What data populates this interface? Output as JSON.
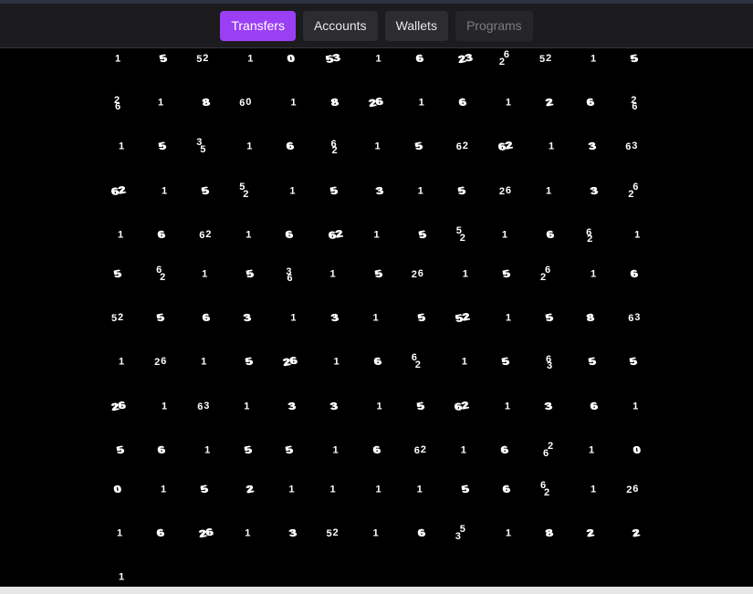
{
  "tabs": [
    {
      "label": "Transfers",
      "state": "active"
    },
    {
      "label": "Accounts",
      "state": "normal"
    },
    {
      "label": "Wallets",
      "state": "normal"
    },
    {
      "label": "Programs",
      "state": "disabled"
    }
  ],
  "colors": {
    "background": "#000000",
    "toolbar": "#1c1c1f",
    "tab": "#2d2d31",
    "tab_active": "#9b3ff5",
    "glyph": "#ffffff"
  },
  "grid": {
    "rows": [
      [
        "1",
        "5",
        "5|2",
        "1",
        "0",
        "53",
        "1",
        "6",
        "23",
        "6|2",
        "5|2",
        "1",
        "5"
      ],
      [
        "2|6",
        "1",
        "8",
        "6|0",
        "1",
        "8",
        "26",
        "1",
        "6",
        "1",
        "2",
        "6",
        "2|6"
      ],
      [
        "1",
        "5",
        "3|5",
        "1",
        "6",
        "6|2",
        "1",
        "5",
        "6|2",
        "62",
        "1",
        "3",
        "6|3"
      ],
      [
        "62",
        "1",
        "5",
        "5|2",
        "1",
        "5",
        "3",
        "1",
        "5",
        "2|6",
        "1",
        "3",
        "6|2"
      ],
      [
        "1",
        "6",
        "6|2",
        "1",
        "6",
        "62",
        "1",
        "5",
        "5|2",
        "1",
        "6",
        "6|2",
        "1"
      ],
      [
        "5",
        "6|2",
        "1",
        "5",
        "3|6",
        "1",
        "5",
        "2|6",
        "1",
        "5",
        "6|2",
        "1",
        "6"
      ],
      [
        "5|2",
        "5",
        "6",
        "3",
        "1",
        "3",
        "1",
        "5",
        "52",
        "1",
        "5",
        "8",
        "6|3"
      ],
      [
        "1",
        "2|6",
        "1",
        "5",
        "26",
        "1",
        "6",
        "6|2",
        "1",
        "5",
        "6|3",
        "5",
        "5"
      ],
      [
        "26",
        "1",
        "6|3",
        "1",
        "3",
        "3",
        "1",
        "5",
        "62",
        "1",
        "3",
        "6",
        "1"
      ],
      [
        "5",
        "6",
        "1",
        "5",
        "5",
        "1",
        "6",
        "6|2",
        "1",
        "6",
        "2|6",
        "1",
        "0"
      ],
      [
        "0",
        "1",
        "5",
        "2",
        "1",
        "1",
        "1",
        "1",
        "5",
        "6",
        "6|2",
        "1",
        "2|6"
      ],
      [
        "1",
        "6",
        "26",
        "1",
        "3",
        "5|2",
        "1",
        "6",
        "5|3",
        "1",
        "8",
        "2",
        "2"
      ],
      [
        "1"
      ]
    ]
  }
}
